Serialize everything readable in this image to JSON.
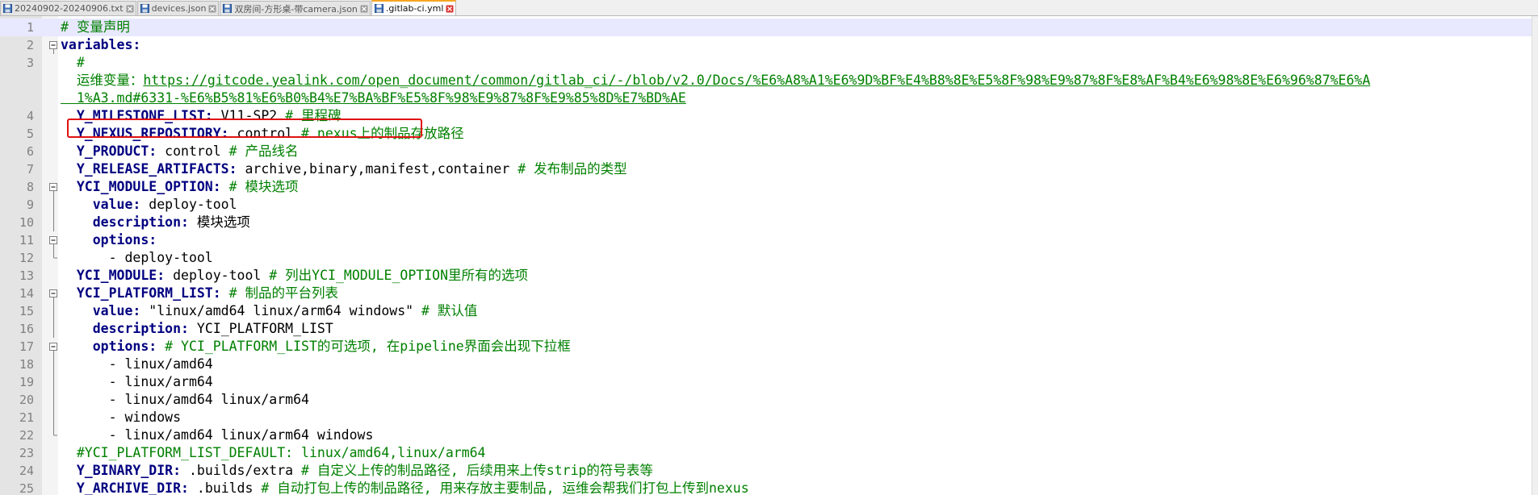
{
  "tabs": [
    {
      "label": "20240902-20240906.txt",
      "active": false
    },
    {
      "label": "devices.json",
      "active": false
    },
    {
      "label": "双房间-方形桌-带camera.json",
      "active": false
    },
    {
      "label": ".gitlab-ci.yml",
      "active": true
    }
  ],
  "lines": [
    {
      "num": "1",
      "fold": "",
      "parts": [
        {
          "t": "# 变量声明",
          "c": "cmt"
        }
      ]
    },
    {
      "num": "2",
      "fold": "open",
      "parts": [
        {
          "t": "variables:",
          "c": "key"
        }
      ]
    },
    {
      "num": "3",
      "fold": "",
      "parts": [
        {
          "t": "  #",
          "c": "cmt"
        }
      ]
    },
    {
      "num": "",
      "fold": "",
      "wrap": true,
      "parts": [
        {
          "t": "  运维变量：",
          "c": "cmt"
        },
        {
          "t": "https://gitcode.yealink.com/open_document/common/gitlab_ci/-/blob/v2.0/Docs/%E6%A8%A1%E6%9D%BF%E4%B8%8E%E5%8F%98%E9%87%8F%E8%AF%B4%E6%98%8E%E6%96%87%E6%A",
          "c": "link"
        }
      ],
      "parts2": [
        {
          "t": "  1%A3.md#6331-%E6%B5%81%E6%B0%B4%E7%BA%BF%E5%8F%98%E9%87%8F%E9%85%8D%E7%BD%AE",
          "c": "link"
        }
      ]
    },
    {
      "num": "4",
      "fold": "",
      "parts": [
        {
          "t": "  Y_MILESTONE_LIST:",
          "c": "key"
        },
        {
          "t": " V11-SP2 ",
          "c": "val"
        },
        {
          "t": "# 里程碑",
          "c": "cmt"
        }
      ]
    },
    {
      "num": "5",
      "fold": "",
      "parts": [
        {
          "t": "  Y_NEXUS_REPOSITORY:",
          "c": "key"
        },
        {
          "t": " control ",
          "c": "val"
        },
        {
          "t": "# nexus上的制品存放路径",
          "c": "cmt"
        }
      ]
    },
    {
      "num": "6",
      "fold": "",
      "parts": [
        {
          "t": "  Y_PRODUCT:",
          "c": "key"
        },
        {
          "t": " control ",
          "c": "val"
        },
        {
          "t": "# 产品线名",
          "c": "cmt"
        }
      ]
    },
    {
      "num": "7",
      "fold": "",
      "parts": [
        {
          "t": "  Y_RELEASE_ARTIFACTS:",
          "c": "key"
        },
        {
          "t": " archive,binary,manifest,container ",
          "c": "val"
        },
        {
          "t": "# 发布制品的类型",
          "c": "cmt"
        }
      ]
    },
    {
      "num": "8",
      "fold": "open",
      "parts": [
        {
          "t": "  YCI_MODULE_OPTION:",
          "c": "key"
        },
        {
          "t": " ",
          "c": "val"
        },
        {
          "t": "# 模块选项",
          "c": "cmt"
        }
      ]
    },
    {
      "num": "9",
      "fold": "line",
      "parts": [
        {
          "t": "    value:",
          "c": "key"
        },
        {
          "t": " deploy-tool",
          "c": "val"
        }
      ]
    },
    {
      "num": "10",
      "fold": "line",
      "parts": [
        {
          "t": "    description:",
          "c": "key"
        },
        {
          "t": " 模块选项",
          "c": "val"
        }
      ]
    },
    {
      "num": "11",
      "fold": "open",
      "parts": [
        {
          "t": "    options:",
          "c": "key"
        }
      ]
    },
    {
      "num": "12",
      "fold": "end",
      "parts": [
        {
          "t": "      - deploy-tool",
          "c": "val"
        }
      ]
    },
    {
      "num": "13",
      "fold": "",
      "parts": [
        {
          "t": "  YCI_MODULE:",
          "c": "key"
        },
        {
          "t": " deploy-tool ",
          "c": "val"
        },
        {
          "t": "# 列出YCI_MODULE_OPTION里所有的选项",
          "c": "cmt"
        }
      ]
    },
    {
      "num": "14",
      "fold": "open",
      "parts": [
        {
          "t": "  YCI_PLATFORM_LIST:",
          "c": "key"
        },
        {
          "t": " ",
          "c": "val"
        },
        {
          "t": "# 制品的平台列表",
          "c": "cmt"
        }
      ]
    },
    {
      "num": "15",
      "fold": "line",
      "parts": [
        {
          "t": "    value:",
          "c": "key"
        },
        {
          "t": " \"linux/amd64 linux/arm64 windows\" ",
          "c": "val"
        },
        {
          "t": "# 默认值",
          "c": "cmt"
        }
      ]
    },
    {
      "num": "16",
      "fold": "line",
      "parts": [
        {
          "t": "    description:",
          "c": "key"
        },
        {
          "t": " YCI_PLATFORM_LIST",
          "c": "val"
        }
      ]
    },
    {
      "num": "17",
      "fold": "open",
      "parts": [
        {
          "t": "    options:",
          "c": "key"
        },
        {
          "t": " ",
          "c": "val"
        },
        {
          "t": "# YCI_PLATFORM_LIST的可选项, 在pipeline界面会出现下拉框",
          "c": "cmt"
        }
      ]
    },
    {
      "num": "18",
      "fold": "line",
      "parts": [
        {
          "t": "      - linux/amd64",
          "c": "val"
        }
      ]
    },
    {
      "num": "19",
      "fold": "line",
      "parts": [
        {
          "t": "      - linux/arm64",
          "c": "val"
        }
      ]
    },
    {
      "num": "20",
      "fold": "line",
      "parts": [
        {
          "t": "      - linux/amd64 linux/arm64",
          "c": "val"
        }
      ]
    },
    {
      "num": "21",
      "fold": "line",
      "parts": [
        {
          "t": "      - windows",
          "c": "val"
        }
      ]
    },
    {
      "num": "22",
      "fold": "end",
      "parts": [
        {
          "t": "      - linux/amd64 linux/arm64 windows",
          "c": "val"
        }
      ]
    },
    {
      "num": "23",
      "fold": "",
      "parts": [
        {
          "t": "  #YCI_PLATFORM_LIST_DEFAULT: linux/amd64,linux/arm64",
          "c": "cmt"
        }
      ]
    },
    {
      "num": "24",
      "fold": "",
      "parts": [
        {
          "t": "  Y_BINARY_DIR:",
          "c": "key"
        },
        {
          "t": " .builds/extra ",
          "c": "val"
        },
        {
          "t": "# 自定义上传的制品路径, 后续用来上传strip的符号表等",
          "c": "cmt"
        }
      ]
    },
    {
      "num": "25",
      "fold": "",
      "parts": [
        {
          "t": "  Y_ARCHIVE_DIR:",
          "c": "key"
        },
        {
          "t": " .builds ",
          "c": "val"
        },
        {
          "t": "# 自动打包上传的制品路径, 用来存放主要制品, 运维会帮我们打包上传到nexus",
          "c": "cmt"
        }
      ]
    }
  ]
}
